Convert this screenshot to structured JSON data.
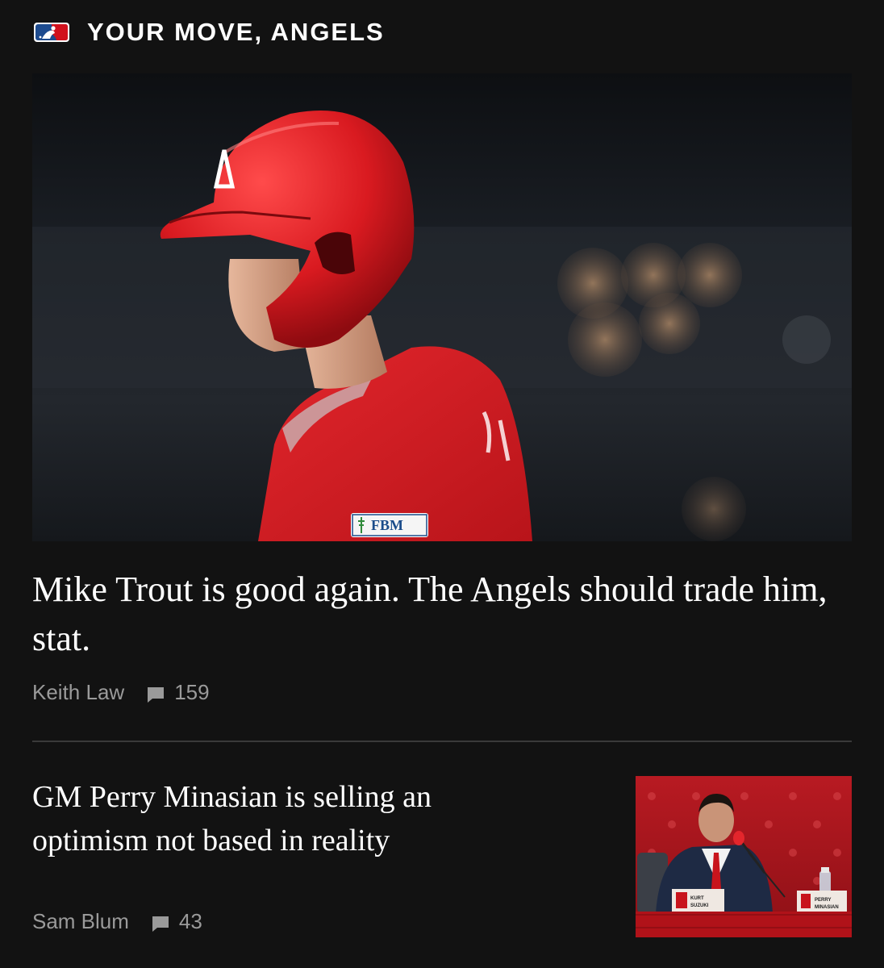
{
  "section": {
    "logo_icon": "mlb-logo-icon",
    "title": "YOUR MOVE, ANGELS"
  },
  "articles": [
    {
      "headline": "Mike Trout is good again. The Angels should trade him, stat.",
      "author": "Keith Law",
      "comment_icon": "comment-icon",
      "comments": "159",
      "image": {
        "subject": "player in red batting helmet",
        "patch_text": "FBM"
      }
    },
    {
      "headline": "GM Perry Minasian is selling an optimism not based in reality",
      "author": "Sam Blum",
      "comment_icon": "comment-icon",
      "comments": "43",
      "image": {
        "subject": "press conference",
        "nameplate_left": "KURT SUZUKI",
        "nameplate_right": "PERRY MINASIAN"
      }
    }
  ],
  "colors": {
    "background": "#121212",
    "headline": "#ffffff",
    "meta": "#9a9a9a",
    "divider": "#3a3a3a",
    "angels_red": "#d1111d"
  }
}
